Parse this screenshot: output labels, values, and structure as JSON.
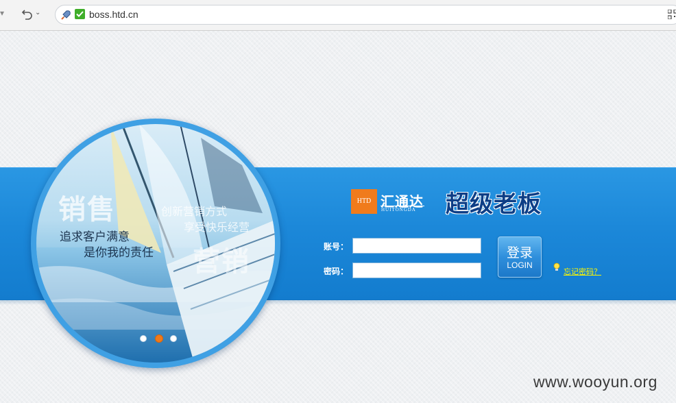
{
  "browser": {
    "url": "boss.htd.cn"
  },
  "brand": {
    "logo_box_text": "HTD",
    "logo_cn": "汇通达",
    "logo_en": "HUITONGDA",
    "product_title": "超级老板"
  },
  "banner": {
    "big_word_1": "销售",
    "big_word_2": "营销",
    "line1": "追求客户满意",
    "line2": "是你我的责任",
    "faint_line1": "创新营销方式",
    "faint_line2": "享受快乐经营"
  },
  "form": {
    "account_label": "账号：",
    "password_label": "密码：",
    "account_value": "",
    "password_value": "",
    "login_cn": "登录",
    "login_en": "LOGIN",
    "forgot_label": "忘记密码？"
  },
  "carousel": {
    "count": 3,
    "active_index": 1
  },
  "watermark": "www.wooyun.org",
  "colors": {
    "band": "#1c88d9",
    "logo_orange": "#f07b1c",
    "forgot_link": "#fff700"
  }
}
